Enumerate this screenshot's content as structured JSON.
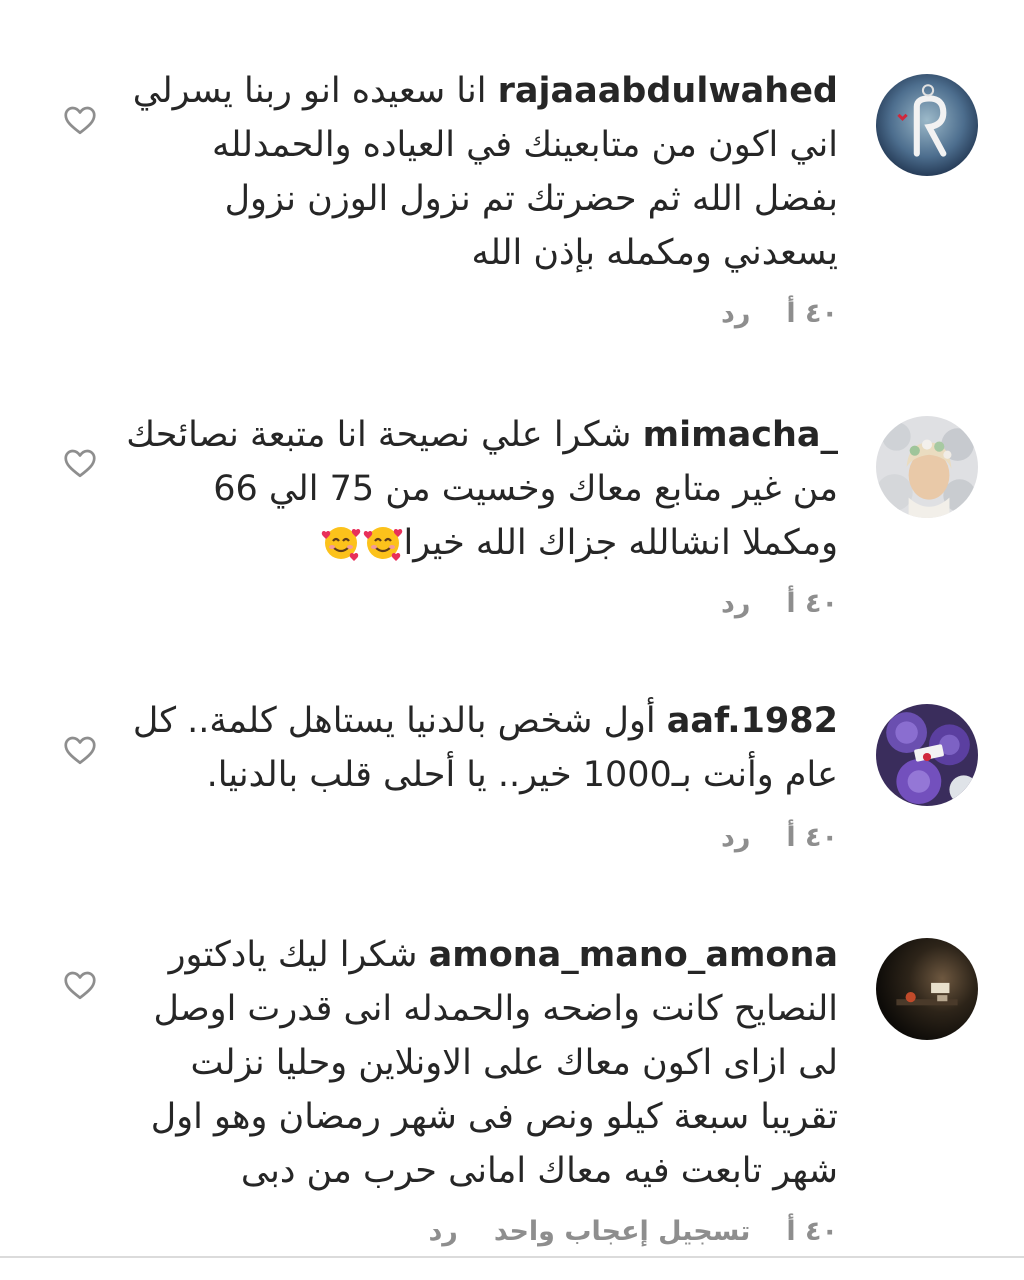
{
  "comments": [
    {
      "username": "rajaaabdulwahed",
      "lines": [
        "انا سعيده انو ربنا يسرلي",
        "اني اكون من متابعينك في العياده والحمدلله",
        "بفضل الله ثم حضرتك تم نزول الوزن نزول",
        "يسعدني ومكمله بإذن الله"
      ],
      "time": "٤٠ أ",
      "reply": "رد",
      "avatar": "letter-r-avatar"
    },
    {
      "username": "mimacha_",
      "lines": [
        "شكرا علي نصيحة انا متبعة نصائحك",
        "من غير متابع معاك وخسيت من 75 الي 66",
        "ومكملا انشالله  جزاك الله خيرا"
      ],
      "emoji": "smiling-face-with-hearts",
      "time": "٤٠ أ",
      "reply": "رد",
      "avatar": "flower-crown-avatar"
    },
    {
      "username": "aaf.1982",
      "lines": [
        "أول شخص بالدنيا يستاهل كلمة.. كل",
        "عام وأنت بـ1000 خير.. يا أحلى قلب بالدنيا."
      ],
      "time": "٤٠ أ",
      "reply": "رد",
      "avatar": "purple-roses-avatar"
    },
    {
      "username": "amona_mano_amona",
      "lines": [
        "شكرا ليك يادكتور",
        "النصايح كانت واضحه والحمدله انى قدرت اوصل",
        "لى ازاى اكون معاك على الاونلاين وحليا نزلت",
        "تقريبا سبعة كيلو ونص فى شهر رمضان وهو اول",
        "شهر تابعت فيه معاك امانى حرب من دبى"
      ],
      "time": "٤٠ أ",
      "likes": "تسجيل إعجاب واحد",
      "reply": "رد",
      "avatar": "dark-room-avatar"
    }
  ],
  "colors": {
    "text": "#262626",
    "secondary": "#8e8e8e",
    "heart_outline": "#8e8e8e"
  }
}
